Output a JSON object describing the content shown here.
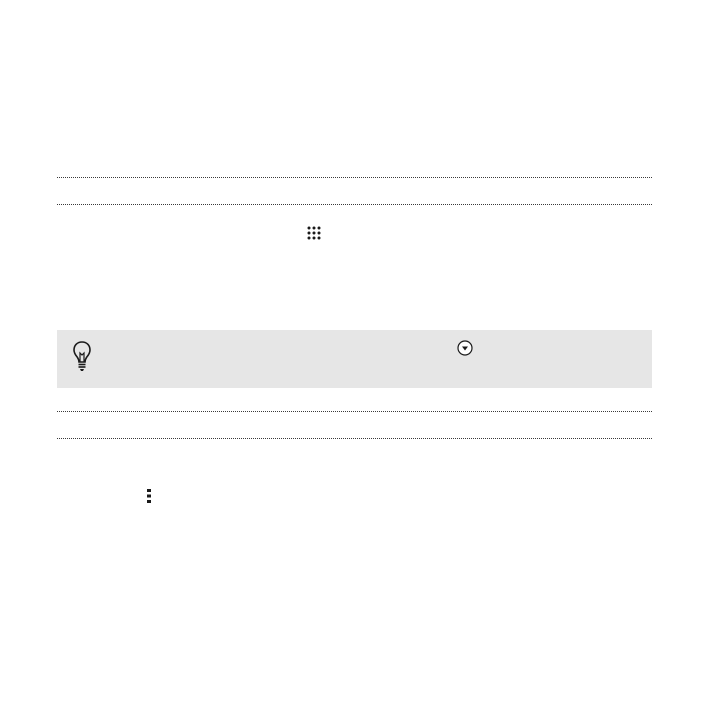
{
  "icons": {
    "apps_grid": "apps-grid-icon",
    "tip_bulb": "lightbulb-icon",
    "expand": "chevron-down-circle-icon",
    "more": "more-vertical-icon"
  },
  "colors": {
    "rule": "#3a3a3a",
    "tip_background": "#e6e6e6",
    "icon": "#1a1a1a"
  }
}
